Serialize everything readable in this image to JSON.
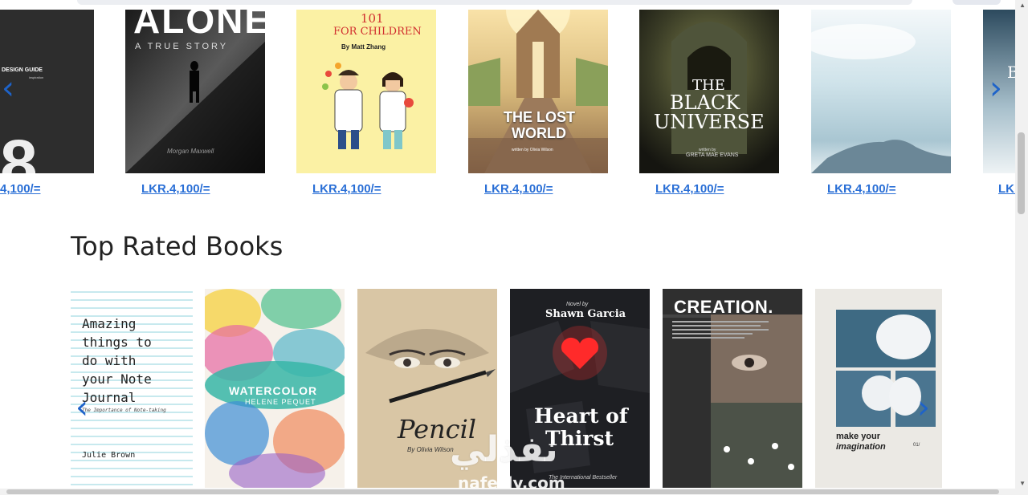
{
  "new_books": {
    "items": [
      {
        "cover_lines": [
          "DESIGN GUIDE",
          "inspiration",
          "8"
        ],
        "price": "4,100/="
      },
      {
        "cover_lines": [
          "ALONE",
          "A TRUE STORY",
          "Morgan Maxwell"
        ],
        "price": "LKR.4,100/="
      },
      {
        "cover_lines": [
          "101",
          "FOR CHILDREN",
          "By Matt Zhang"
        ],
        "price": "LKR.4,100/="
      },
      {
        "cover_lines": [
          "THE LOST",
          "WORLD",
          "written by Olivia Wilson"
        ],
        "price": "LKR.4,100/="
      },
      {
        "cover_lines": [
          "THE",
          "BLACK",
          "UNIVERSE",
          "written by",
          "GRETA MAE EVANS"
        ],
        "price": "LKR.4,100/="
      },
      {
        "cover_lines": [],
        "price": "LKR.4,100/="
      },
      {
        "cover_lines": [
          "B"
        ],
        "price": "LKF"
      }
    ]
  },
  "top_rated": {
    "title": "Top Rated Books",
    "items": [
      {
        "cover_lines": [
          "Amazing",
          "things to",
          "do with",
          "your Note",
          "Journal",
          "The Importance of Note-taking",
          "Julie Brown"
        ]
      },
      {
        "cover_lines": [
          "WATERCOLOR",
          "HELENE PEQUET"
        ]
      },
      {
        "cover_lines": [
          "Pencil",
          "By Olivia Wilson"
        ]
      },
      {
        "cover_lines": [
          "Novel by",
          "Shawn Garcia",
          "Heart of",
          "Thirst",
          "The International Bestseller"
        ]
      },
      {
        "cover_lines": [
          "CREATION."
        ]
      },
      {
        "cover_lines": [
          "make your",
          "imagination",
          "01/"
        ]
      }
    ]
  },
  "icons": {
    "prev": "chevron-left-icon",
    "next": "chevron-right-icon"
  },
  "watermark": {
    "main": "نفذلي",
    "sub": "nafezly.com"
  },
  "colors": {
    "price_link": "#2a6fd6",
    "arrow": "#1e63c9"
  }
}
